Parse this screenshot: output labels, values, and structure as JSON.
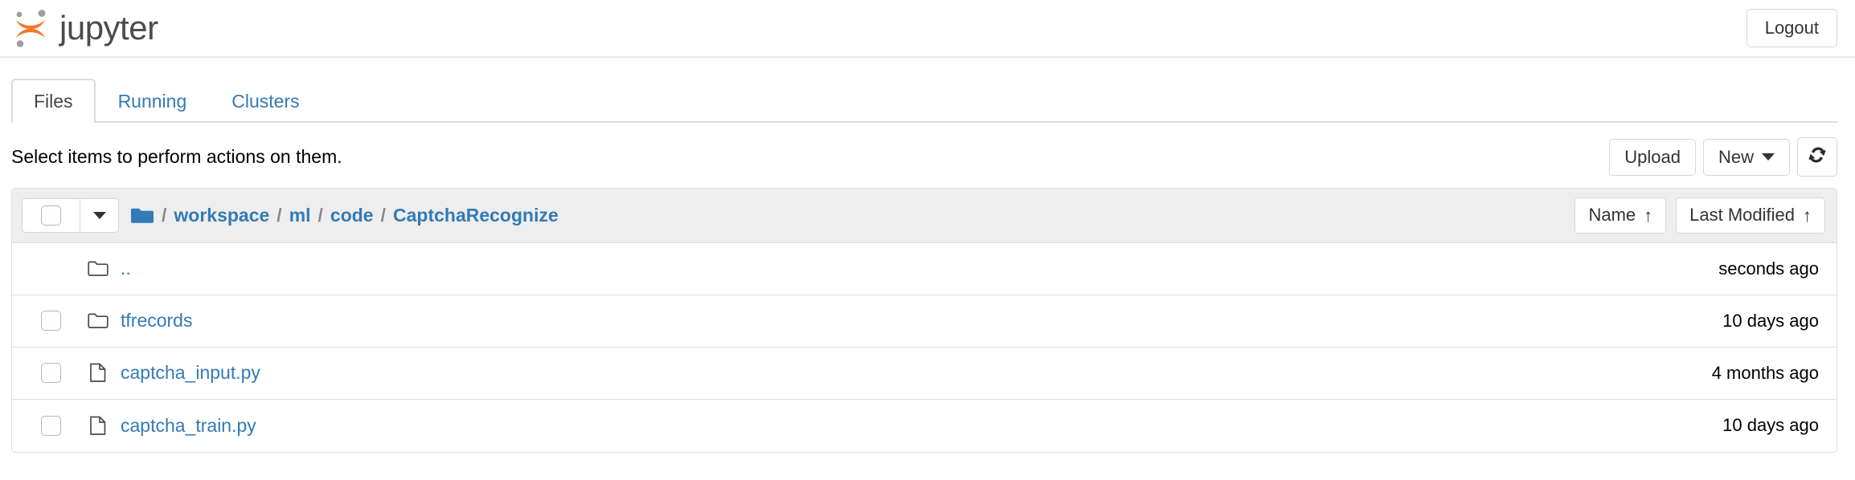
{
  "header": {
    "brand_name": "jupyter",
    "logo_icon": "jupyter-logo",
    "logout_label": "Logout"
  },
  "tabs": [
    {
      "label": "Files",
      "active": true
    },
    {
      "label": "Running",
      "active": false
    },
    {
      "label": "Clusters",
      "active": false
    }
  ],
  "toolbar": {
    "instruction": "Select items to perform actions on them.",
    "upload_label": "Upload",
    "new_label": "New",
    "new_caret_icon": "caret-down-icon",
    "refresh_icon": "refresh-icon"
  },
  "breadcrumb": {
    "root_icon": "folder-icon",
    "separator": "/",
    "items": [
      {
        "label": "workspace"
      },
      {
        "label": "ml"
      },
      {
        "label": "code"
      },
      {
        "label": "CaptchaRecognize"
      }
    ]
  },
  "select_all": {
    "checkbox_icon": "checkbox-unchecked-icon",
    "caret_icon": "caret-down-icon"
  },
  "sort": {
    "name_label": "Name",
    "name_arrow": "↑",
    "modified_label": "Last Modified",
    "modified_arrow": "↑"
  },
  "files": [
    {
      "name": "..",
      "icon": "folder-icon",
      "type": "directory",
      "has_checkbox": false,
      "modified": "seconds ago"
    },
    {
      "name": "tfrecords",
      "icon": "folder-icon",
      "type": "directory",
      "has_checkbox": true,
      "modified": "10 days ago"
    },
    {
      "name": "captcha_input.py",
      "icon": "file-icon",
      "type": "file",
      "has_checkbox": true,
      "modified": "4 months ago"
    },
    {
      "name": "captcha_train.py",
      "icon": "file-icon",
      "type": "file",
      "has_checkbox": true,
      "modified": "10 days ago"
    }
  ],
  "colors": {
    "link_blue": "#337ab7",
    "logo_orange": "#f37726",
    "logo_gray": "#9e9e9e",
    "header_bg": "#eeeeee",
    "border": "#dddddd"
  }
}
